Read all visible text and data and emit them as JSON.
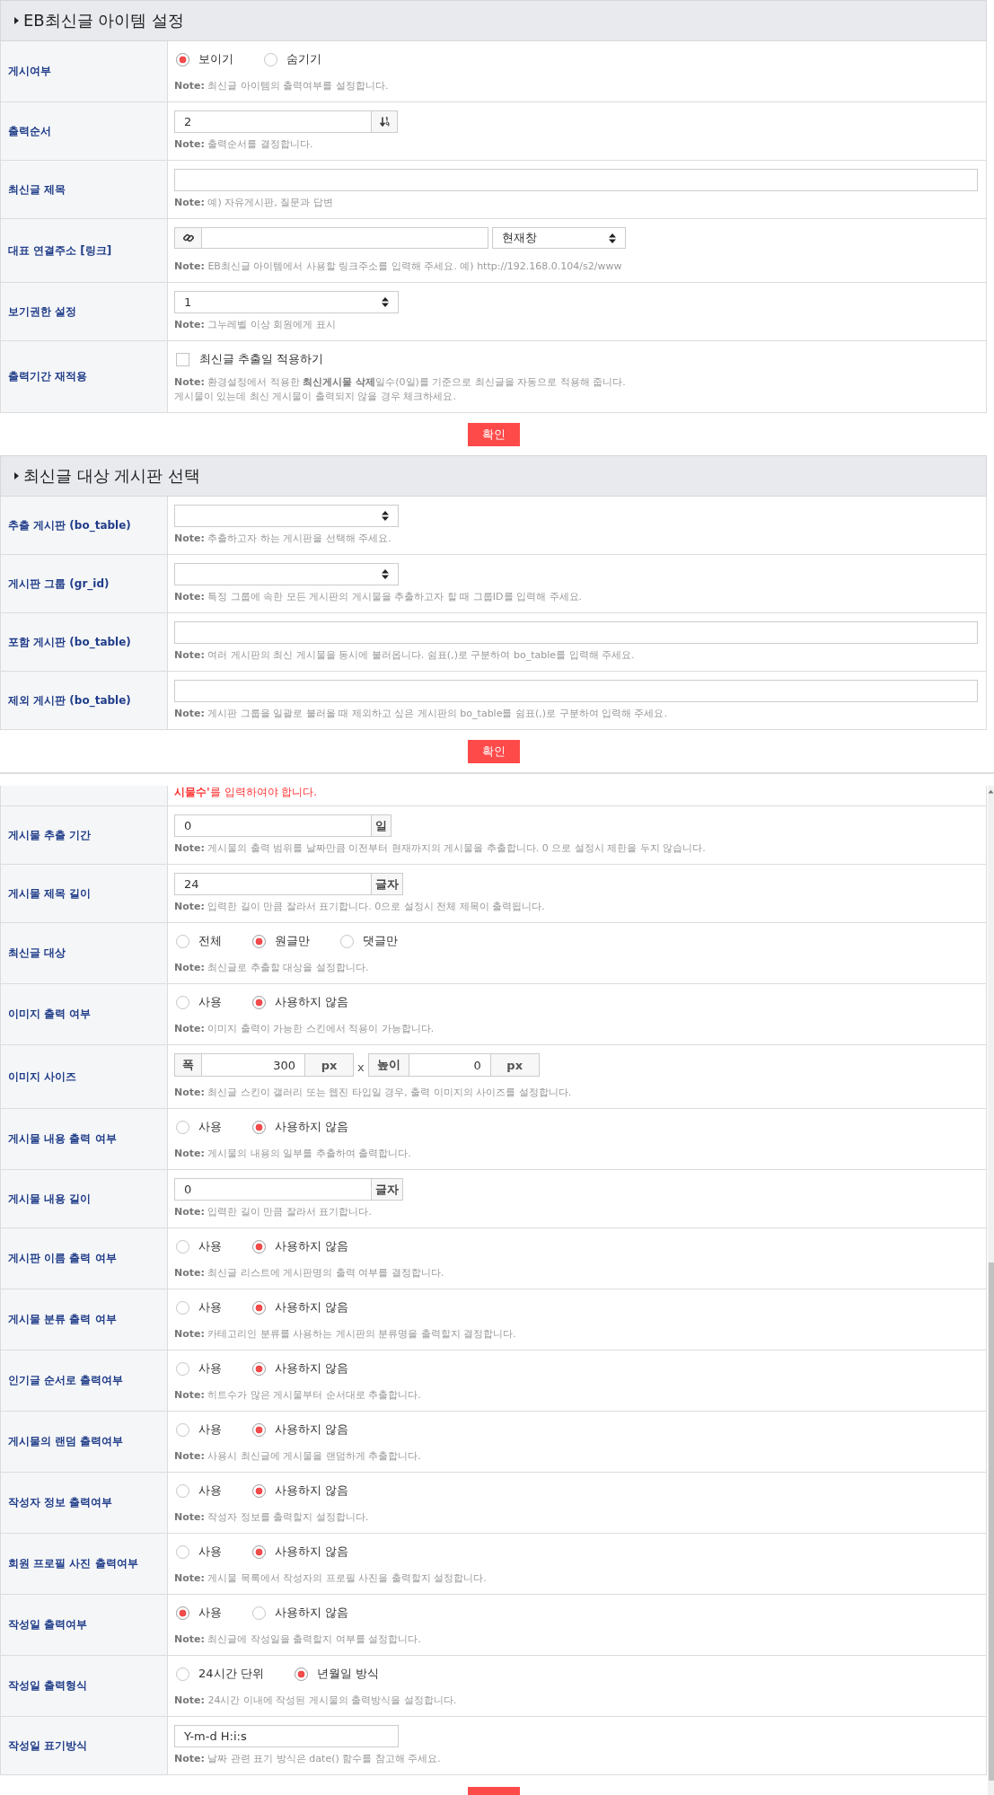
{
  "sections": [
    {
      "title": "EB최신글 아이템 설정",
      "button": "확인",
      "rows": [
        {
          "label": "게시여부",
          "kind": "radio",
          "options": [
            {
              "label": "보이기",
              "selected": true
            },
            {
              "label": "숨기기",
              "selected": false
            }
          ],
          "notes": [
            "**Note:** 최신글 아이템의 출력여부를 설정합니다."
          ]
        },
        {
          "label": "출력순서",
          "kind": "sort",
          "value": "2",
          "notes": [
            "**Note:** 출력순서를 결정합니다."
          ]
        },
        {
          "label": "최신글 제목",
          "kind": "text",
          "notes": [
            "**Note:** 예) 자유게시판, 질문과 답변"
          ]
        },
        {
          "label": "대표 연결주소 [링크]",
          "kind": "link",
          "target": "현재창",
          "notes": [
            "**Note:** EB최신글 아이템에서 사용할 링크주소를 입력해 주세요. 예) http://192.168.0.104/s2/www"
          ]
        },
        {
          "label": "보기권한 설정",
          "kind": "select",
          "value": "1",
          "notes": [
            "**Note:** 그누레벨 이상 회원에게 표시"
          ]
        },
        {
          "label": "출력기간 재적용",
          "kind": "checkbox",
          "option": "최신글 추출일 적용하기",
          "checked": false,
          "notes": [
            "**Note:** 환경설정에서 적용한 **최신게시물 삭제**일수(0일)를 기준으로 최신글을 자동으로 적용해 줍니다.",
            "게시물이 있는데 최신 게시물이 출력되지 않을 경우 체크하세요."
          ]
        }
      ]
    },
    {
      "title": "최신글 대상 게시판 선택",
      "button": "확인",
      "rows": [
        {
          "label": "추출 게시판 (bo_table)",
          "kind": "select",
          "notes": [
            "**Note:** 추출하고자 하는 게시판을 선택해 주세요."
          ]
        },
        {
          "label": "게시판 그룹 (gr_id)",
          "kind": "select",
          "notes": [
            "**Note:** 특정 그룹에 속한 모든 게시판의 게시물을 추출하고자 할 때 그룹ID를 입력해 주세요."
          ]
        },
        {
          "label": "포함 게시판 (bo_table)",
          "kind": "text",
          "notes": [
            "**Note:** 여러 게시판의 최신 게시물을 동시에 불러옵니다. 쉼표(,)로 구분하여 bo_table를 입력해 주세요."
          ]
        },
        {
          "label": "제외 게시판 (bo_table)",
          "kind": "text",
          "notes": [
            "**Note:** 게시판 그룹을 일괄로 불러올 때 제외하고 싶은 게시판의 bo_table를 쉼표(,)로 구분하여 입력해 주세요."
          ]
        }
      ]
    }
  ],
  "panel": {
    "alert": "**시물수'**를 입력하여야 합니다.",
    "rows": [
      {
        "label": "게시물 추출 기간",
        "kind": "input",
        "value": "0",
        "unit": "일",
        "notes": [
          "**Note:** 게시물의 출력 범위를 날짜만큼 이전부터 현재까지의 게시물을 추출합니다. 0 으로 설정시 제한을 두지 않습니다."
        ]
      },
      {
        "label": "게시물 제목 길이",
        "kind": "input",
        "value": "24",
        "unit": "글자",
        "notes": [
          "**Note:** 입력한 길이 만큼 잘라서 표기합니다. 0으로 설정시 전체 제목이 출력됩니다."
        ]
      },
      {
        "label": "최신글 대상",
        "kind": "radio",
        "options": [
          {
            "label": "전체",
            "selected": false
          },
          {
            "label": "원글만",
            "selected": true
          },
          {
            "label": "댓글만",
            "selected": false
          }
        ],
        "notes": [
          "**Note:** 최신글로 추출할 대상을 설정합니다."
        ]
      },
      {
        "label": "이미지 출력 여부",
        "kind": "radio",
        "options": [
          {
            "label": "사용",
            "selected": false
          },
          {
            "label": "사용하지 않음",
            "selected": true
          }
        ],
        "notes": [
          "**Note:** 이미지 출력이 가능한 스킨에서 적용이 가능합니다."
        ]
      },
      {
        "label": "이미지 사이즈",
        "kind": "size",
        "separator": "x",
        "fields": [
          {
            "label": "폭",
            "value": "300",
            "unit": "px"
          },
          {
            "label": "높이",
            "value": "0",
            "unit": "px"
          }
        ],
        "notes": [
          "**Note:** 최신글 스킨이 갤러리 또는 웹진 타입일 경우, 출력 이미지의 사이즈를 설정합니다."
        ]
      },
      {
        "label": "게시물 내용 출력 여부",
        "kind": "radio",
        "options": [
          {
            "label": "사용",
            "selected": false
          },
          {
            "label": "사용하지 않음",
            "selected": true
          }
        ],
        "notes": [
          "**Note:** 게시물의 내용의 일부를 추출하여 출력합니다."
        ]
      },
      {
        "label": "게시물 내용 길이",
        "kind": "input",
        "value": "0",
        "unit": "글자",
        "notes": [
          "**Note:** 입력한 길이 만큼 잘라서 표기합니다."
        ]
      },
      {
        "label": "게시판 이름 출력 여부",
        "kind": "radio",
        "options": [
          {
            "label": "사용",
            "selected": false
          },
          {
            "label": "사용하지 않음",
            "selected": true
          }
        ],
        "notes": [
          "**Note:** 최신글 리스트에 게시판명의 출력 여부를 결정합니다."
        ]
      },
      {
        "label": "게시물 분류 출력 여부",
        "kind": "radio",
        "options": [
          {
            "label": "사용",
            "selected": false
          },
          {
            "label": "사용하지 않음",
            "selected": true
          }
        ],
        "notes": [
          "**Note:** 카테고리인 분류를 사용하는 게시판의 분류명을 출력할지 결정합니다."
        ]
      },
      {
        "label": "인기글 순서로 출력여부",
        "kind": "radio",
        "options": [
          {
            "label": "사용",
            "selected": false
          },
          {
            "label": "사용하지 않음",
            "selected": true
          }
        ],
        "notes": [
          "**Note:** 히트수가 많은 게시물부터 순서대로 추출합니다."
        ]
      },
      {
        "label": "게시물의 랜덤 출력여부",
        "kind": "radio",
        "options": [
          {
            "label": "사용",
            "selected": false
          },
          {
            "label": "사용하지 않음",
            "selected": true
          }
        ],
        "notes": [
          "**Note:** 사용시 최신글에 게시물을 랜덤하게 추출합니다."
        ]
      },
      {
        "label": "작성자 정보 출력여부",
        "kind": "radio",
        "options": [
          {
            "label": "사용",
            "selected": false
          },
          {
            "label": "사용하지 않음",
            "selected": true
          }
        ],
        "notes": [
          "**Note:** 작성자 정보를 출력할지 설정합니다."
        ]
      },
      {
        "label": "회원 프로필 사진 출력여부",
        "kind": "radio",
        "options": [
          {
            "label": "사용",
            "selected": false
          },
          {
            "label": "사용하지 않음",
            "selected": true
          }
        ],
        "notes": [
          "**Note:** 게시물 목록에서 작성자의 프로필 사진을 출력할지 설정합니다."
        ]
      },
      {
        "label": "작성일 출력여부",
        "kind": "radio",
        "options": [
          {
            "label": "사용",
            "selected": true
          },
          {
            "label": "사용하지 않음",
            "selected": false
          }
        ],
        "notes": [
          "**Note:** 최신글에 작성일을 출력할지 여부를 설정합니다."
        ]
      },
      {
        "label": "작성일 출력형식",
        "kind": "radio",
        "options": [
          {
            "label": "24시간 단위",
            "selected": false
          },
          {
            "label": "년월일 방식",
            "selected": true
          }
        ],
        "notes": [
          "**Note:** 24시간 이내에 작성된 게시물의 출력방식을 설정합니다."
        ]
      },
      {
        "label": "작성일 표기방식",
        "kind": "input",
        "value": "Y-m-d H:i:s",
        "notes": [
          "**Note:** 날짜 관련 표기 방식은 date() 함수를 참고해 주세요."
        ]
      }
    ]
  }
}
